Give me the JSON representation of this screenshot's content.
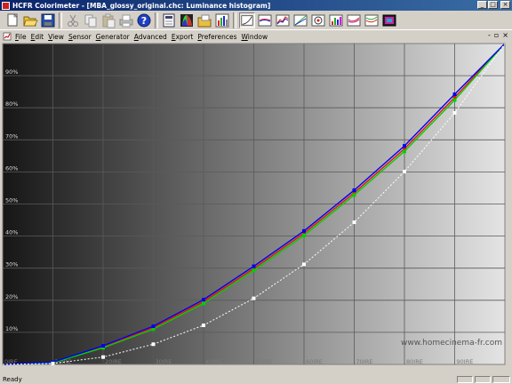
{
  "window": {
    "title": "HCFR Colorimeter - [MBA_glossy_original.chc: Luminance histogram]"
  },
  "title_buttons": {
    "minimize": "_",
    "maximize": "□",
    "close": "×"
  },
  "toolbar": {
    "buttons": [
      {
        "name": "new-icon",
        "active": false
      },
      {
        "name": "open-icon",
        "active": false
      },
      {
        "name": "save-icon",
        "active": false
      },
      {
        "name": "cut-icon",
        "active": false
      },
      {
        "name": "copy-icon",
        "active": false
      },
      {
        "name": "paste-icon",
        "active": false
      },
      {
        "name": "print-icon",
        "active": false
      },
      {
        "name": "help-icon",
        "active": false
      },
      {
        "name": "measures-view-icon",
        "active": false
      },
      {
        "name": "cie-diagram-icon",
        "active": false
      },
      {
        "name": "open-folder-view-icon",
        "active": false
      },
      {
        "name": "rgb-histogram-icon",
        "active": false
      },
      {
        "name": "luminance-view-icon",
        "active": true
      },
      {
        "name": "gamma-view-icon",
        "active": false
      },
      {
        "name": "rgb-levels-icon",
        "active": false
      },
      {
        "name": "saturation-view-icon",
        "active": false
      },
      {
        "name": "color-temperature-icon",
        "active": false
      },
      {
        "name": "color-delta-icon",
        "active": false
      },
      {
        "name": "nearblack-view-icon",
        "active": false
      },
      {
        "name": "nearwhite-view-icon",
        "active": false
      },
      {
        "name": "film-view-icon",
        "active": false
      }
    ]
  },
  "menu": [
    "File",
    "Edit",
    "View",
    "Sensor",
    "Generator",
    "Advanced",
    "Export",
    "Preferences",
    "Window"
  ],
  "mdi_buttons": [
    "-",
    "▫",
    "×"
  ],
  "chart_data": {
    "type": "line",
    "title": "",
    "xlabel": "",
    "ylabel": "",
    "x": [
      0,
      10,
      20,
      30,
      40,
      50,
      60,
      70,
      80,
      90,
      100
    ],
    "xlim": [
      0,
      100
    ],
    "ylim": [
      0,
      100
    ],
    "x_tick_labels": [
      "0IRE",
      "10IRE",
      "20IRE",
      "30IRE",
      "40IRE",
      "50IRE",
      "60IRE",
      "70IRE",
      "80IRE",
      "90IRE"
    ],
    "y_tick_labels": [
      "10%",
      "20%",
      "30%",
      "40%",
      "50%",
      "60%",
      "70%",
      "80%",
      "90%"
    ],
    "y_ticks": [
      10,
      20,
      30,
      40,
      50,
      60,
      70,
      80,
      90
    ],
    "grid": true,
    "watermark": "www.homecinema-fr.com",
    "series": [
      {
        "color": "#f01010",
        "values": [
          0,
          0.6,
          5.5,
          11.5,
          19.6,
          29.9,
          40.9,
          53.5,
          67.2,
          83.2,
          100
        ]
      },
      {
        "color": "#00d000",
        "values": [
          0,
          0.5,
          5.2,
          11.0,
          19.0,
          29.3,
          40.2,
          52.8,
          66.4,
          82.4,
          100
        ]
      },
      {
        "color": "#0000ee",
        "values": [
          0,
          0.7,
          5.8,
          11.9,
          20.2,
          30.6,
          41.6,
          54.3,
          68.1,
          84.2,
          100
        ]
      },
      {
        "color": "#ffffff",
        "dashed": true,
        "marker": "square",
        "values": [
          0,
          0.3,
          2.3,
          6.3,
          12.2,
          20.6,
          31.2,
          44.3,
          60.1,
          78.4,
          100
        ]
      }
    ]
  },
  "status": {
    "text": "Ready"
  }
}
